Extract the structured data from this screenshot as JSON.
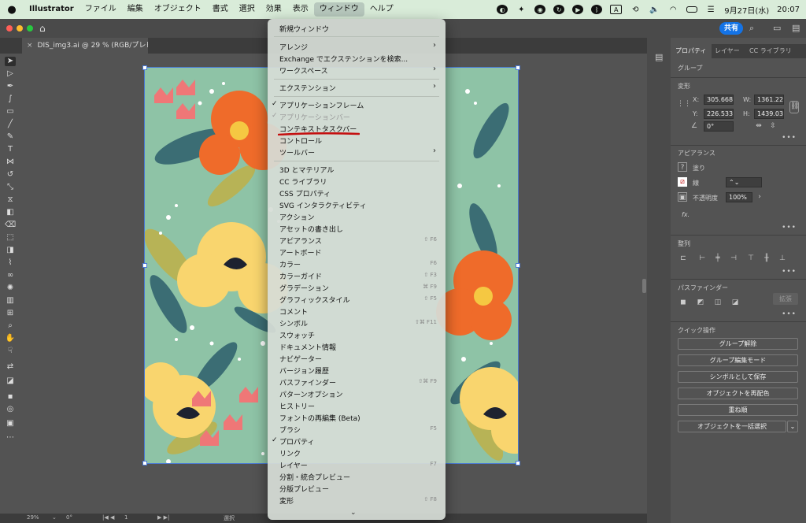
{
  "menubar": {
    "app": "Illustrator",
    "items": [
      "ファイル",
      "編集",
      "オブジェクト",
      "書式",
      "選択",
      "効果",
      "表示",
      "ウィンドウ",
      "ヘルプ"
    ],
    "active": "ウィンドウ",
    "date": "9月27日(水)",
    "time": "20:07",
    "input_label": "A"
  },
  "appbar": {
    "share_label": "共有"
  },
  "document": {
    "tab_title": "DIS_img3.ai @ 29 % (RGB/プレビュー)",
    "close": "×"
  },
  "statusbar": {
    "zoom": "29%",
    "rotation": "0°",
    "artboard": "1",
    "mode": "選択"
  },
  "panel": {
    "tabs": [
      "プロパティ",
      "レイヤー",
      "CC ライブラリ"
    ],
    "object_type": "グループ",
    "transform": {
      "title": "変形",
      "x_label": "X:",
      "x": "305.668",
      "y_label": "Y:",
      "y": "226.533",
      "w_label": "W:",
      "w": "1361.22",
      "h_label": "H:",
      "h": "1439.03",
      "angle": "0°"
    },
    "appearance": {
      "title": "アピアランス",
      "fill_label": "塗り",
      "stroke_label": "線",
      "opacity_label": "不透明度",
      "opacity": "100%",
      "fx": "fx."
    },
    "align_title": "整列",
    "pathfinder_title": "パスファインダー",
    "expand_label": "拡張",
    "quick_title": "クイック操作",
    "quick_actions": [
      "グループ解除",
      "グループ編集モード",
      "シンボルとして保存",
      "オブジェクトを再配色",
      "重ね順",
      "オブジェクトを一括選択"
    ],
    "more": "•••"
  },
  "window_menu": {
    "items": [
      {
        "label": "新規ウィンドウ"
      },
      {
        "label": "アレンジ",
        "submenu": true
      },
      {
        "label": "Exchange でエクステンションを検索..."
      },
      {
        "label": "ワークスペース",
        "submenu": true
      },
      {
        "label": "エクステンション",
        "submenu": true
      },
      {
        "label": "アプリケーションフレーム",
        "checked": true
      },
      {
        "label": "アプリケーションバー",
        "checked": true,
        "disabled": true
      },
      {
        "label": "コンテキストタスクバー"
      },
      {
        "label": "コントロール"
      },
      {
        "label": "ツールバー",
        "submenu": true
      },
      {
        "label": "3D とマテリアル"
      },
      {
        "label": "CC ライブラリ"
      },
      {
        "label": "CSS プロパティ"
      },
      {
        "label": "SVG インタラクティビティ"
      },
      {
        "label": "アクション"
      },
      {
        "label": "アセットの書き出し"
      },
      {
        "label": "アピアランス",
        "shortcut": "⇧ F6"
      },
      {
        "label": "アートボード"
      },
      {
        "label": "カラー",
        "shortcut": "F6"
      },
      {
        "label": "カラーガイド",
        "shortcut": "⇧ F3"
      },
      {
        "label": "グラデーション",
        "shortcut": "⌘ F9"
      },
      {
        "label": "グラフィックスタイル",
        "shortcut": "⇧ F5"
      },
      {
        "label": "コメント"
      },
      {
        "label": "シンボル",
        "shortcut": "⇧⌘ F11"
      },
      {
        "label": "スウォッチ"
      },
      {
        "label": "ドキュメント情報"
      },
      {
        "label": "ナビゲーター"
      },
      {
        "label": "バージョン履歴"
      },
      {
        "label": "パスファインダー",
        "shortcut": "⇧⌘ F9"
      },
      {
        "label": "パターンオプション"
      },
      {
        "label": "ヒストリー"
      },
      {
        "label": "フォントの再編集 (Beta)"
      },
      {
        "label": "ブラシ",
        "shortcut": "F5"
      },
      {
        "label": "プロパティ",
        "checked": true
      },
      {
        "label": "リンク"
      },
      {
        "label": "レイヤー",
        "shortcut": "F7"
      },
      {
        "label": "分割・統合プレビュー"
      },
      {
        "label": "分版プレビュー"
      },
      {
        "label": "変形",
        "shortcut": "⇧ F8"
      }
    ]
  },
  "colors": {
    "accent": "#1473e6",
    "artboard_bg": "#8ec3a6",
    "annotation": "#c41010"
  }
}
